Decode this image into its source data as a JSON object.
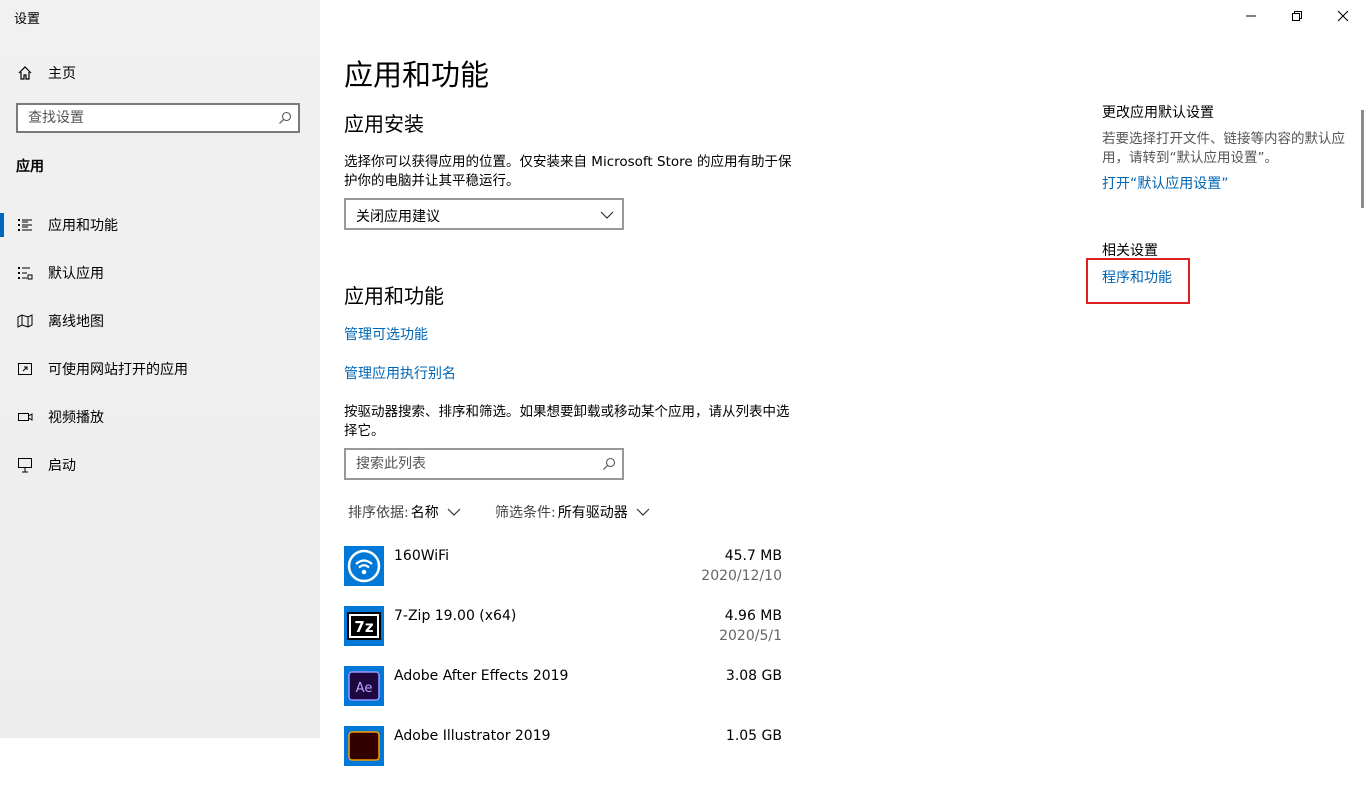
{
  "window": {
    "title": "设置",
    "controls": {
      "minimize": "minimize",
      "restore": "restore",
      "close": "close"
    }
  },
  "sidebar": {
    "home_label": "主页",
    "search_placeholder": "查找设置",
    "section_label": "应用",
    "items": [
      {
        "label": "应用和功能",
        "icon": "apps-list-icon",
        "active": true
      },
      {
        "label": "默认应用",
        "icon": "default-apps-icon",
        "active": false
      },
      {
        "label": "离线地图",
        "icon": "map-icon",
        "active": false
      },
      {
        "label": "可使用网站打开的应用",
        "icon": "open-external-icon",
        "active": false
      },
      {
        "label": "视频播放",
        "icon": "video-icon",
        "active": false
      },
      {
        "label": "启动",
        "icon": "startup-icon",
        "active": false
      }
    ]
  },
  "main": {
    "page_title": "应用和功能",
    "install": {
      "heading": "应用安装",
      "description": "选择你可以获得应用的位置。仅安装来自 Microsoft Store 的应用有助于保护你的电脑并让其平稳运行。",
      "select_value": "关闭应用建议"
    },
    "apps": {
      "heading": "应用和功能",
      "manage_optional_link": "管理可选功能",
      "manage_alias_link": "管理应用执行别名",
      "description": "按驱动器搜索、排序和筛选。如果想要卸载或移动某个应用，请从列表中选择它。",
      "search_placeholder": "搜索此列表",
      "sort_label": "排序依据:",
      "sort_value": "名称",
      "filter_label": "筛选条件:",
      "filter_value": "所有驱动器",
      "list": [
        {
          "name": "160WiFi",
          "size": "45.7 MB",
          "date": "2020/12/10"
        },
        {
          "name": "7-Zip 19.00 (x64)",
          "size": "4.96 MB",
          "date": "2020/5/1"
        },
        {
          "name": "Adobe After Effects 2019",
          "size": "3.08 GB",
          "date": ""
        },
        {
          "name": "Adobe Illustrator 2019",
          "size": "1.05 GB",
          "date": ""
        }
      ]
    }
  },
  "right_panel": {
    "defaults_title": "更改应用默认设置",
    "defaults_desc": "若要选择打开文件、链接等内容的默认应用，请转到“默认应用设置”。",
    "defaults_link": "打开“默认应用设置”",
    "related_title": "相关设置",
    "related_link": "程序和功能"
  },
  "colors": {
    "accent": "#0067c0",
    "link": "#0066b4",
    "highlight": "#e02020"
  }
}
